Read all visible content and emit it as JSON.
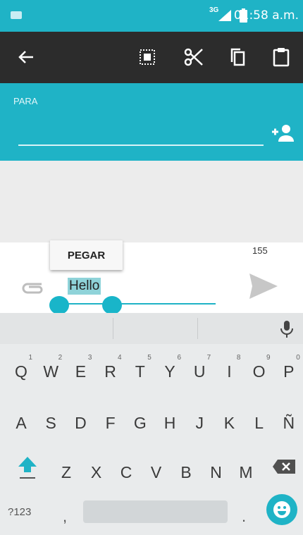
{
  "status_bar": {
    "network": "3G",
    "time": "01:58 a.m."
  },
  "action_bar": {
    "icons": [
      "back-arrow-icon",
      "select-all-icon",
      "cut-icon",
      "copy-icon",
      "paste-clipboard-icon"
    ]
  },
  "recipient": {
    "label": "PARA",
    "add_contact_icon": "add-contact-icon"
  },
  "compose": {
    "char_counter": "155",
    "message_text": "Hello",
    "paste_popup_label": "PEGAR",
    "send_icon": "send-icon",
    "attach_icon": "attach-icon"
  },
  "keyboard": {
    "row1": [
      {
        "k": "Q",
        "h": "1"
      },
      {
        "k": "W",
        "h": "2"
      },
      {
        "k": "E",
        "h": "3"
      },
      {
        "k": "R",
        "h": "4"
      },
      {
        "k": "T",
        "h": "5"
      },
      {
        "k": "Y",
        "h": "6"
      },
      {
        "k": "U",
        "h": "7"
      },
      {
        "k": "I",
        "h": "8"
      },
      {
        "k": "O",
        "h": "9"
      },
      {
        "k": "P",
        "h": "0"
      }
    ],
    "row2": [
      "A",
      "S",
      "D",
      "F",
      "G",
      "H",
      "J",
      "K",
      "L",
      "Ñ"
    ],
    "row3": [
      "Z",
      "X",
      "C",
      "V",
      "B",
      "N",
      "M"
    ],
    "symbols_key": "?123",
    "comma_key": ",",
    "period_key": ".",
    "accent_color": "#1fb3c6"
  }
}
